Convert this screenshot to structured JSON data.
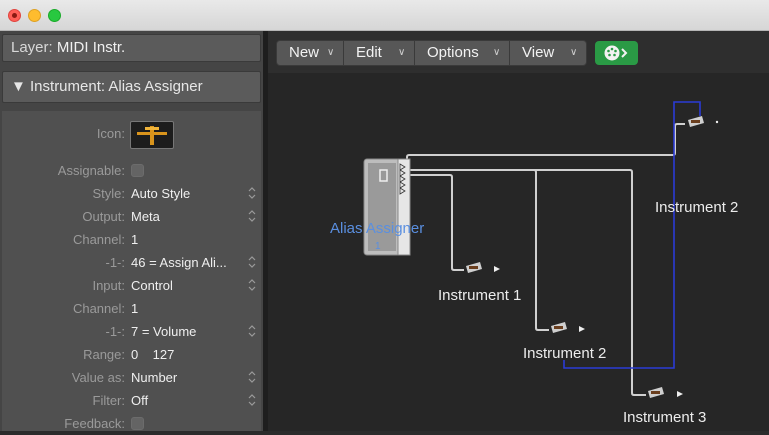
{
  "window": {
    "traffic_lights": [
      "close",
      "minimize",
      "zoom"
    ]
  },
  "inspector": {
    "layer_label": "Layer:",
    "layer_value": "MIDI Instr.",
    "instrument_header": "▼ Instrument:  Alias Assigner",
    "params": [
      {
        "label": "Icon:",
        "value": "",
        "kind": "icon"
      },
      {
        "label": "Assignable:",
        "value": "",
        "kind": "checkbox"
      },
      {
        "label": "Style:",
        "value": "Auto Style",
        "kind": "popup"
      },
      {
        "label": "Output:",
        "value": "Meta",
        "kind": "popup"
      },
      {
        "label": "Channel:",
        "value": "1",
        "kind": "text"
      },
      {
        "label": "-1-:",
        "value": "46 = Assign Ali...",
        "kind": "popup"
      },
      {
        "label": "Input:",
        "value": "Control",
        "kind": "popup"
      },
      {
        "label": "Channel:",
        "value": "1",
        "kind": "text"
      },
      {
        "label": "-1-:",
        "value": "7 = Volume",
        "kind": "popup"
      },
      {
        "label": "Range:",
        "value": "0    127",
        "kind": "text"
      },
      {
        "label": "Value as:",
        "value": "Number",
        "kind": "popup"
      },
      {
        "label": "Filter:",
        "value": "Off",
        "kind": "popup"
      },
      {
        "label": "Feedback:",
        "value": "",
        "kind": "checkbox"
      }
    ]
  },
  "toolbar": {
    "new_label": "New",
    "edit_label": "Edit",
    "options_label": "Options",
    "view_label": "View",
    "chevron": "∨",
    "midi_button_icon": "midi-out-icon"
  },
  "canvas": {
    "alias_assigner_label": "Alias Assigner",
    "objects": [
      {
        "label": "Instrument 1"
      },
      {
        "label": "Instrument 2"
      },
      {
        "label": "Instrument 2"
      },
      {
        "label": "Instrument 3"
      }
    ]
  },
  "colors": {
    "midi_button": "#2a9a45",
    "alias_label": "#5a8fe0",
    "cable": "#d0d0d0",
    "selected_cable": "#2a3bd6"
  }
}
